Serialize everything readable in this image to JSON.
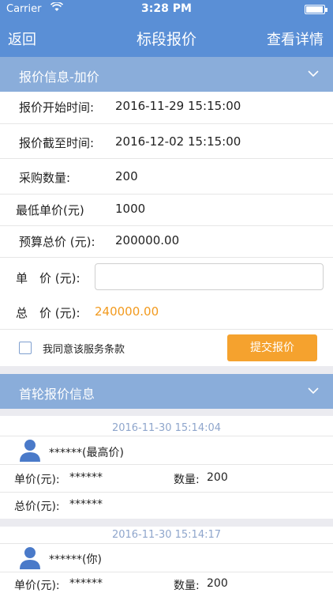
{
  "status_bar": {
    "carrier": "Carrier",
    "time": "3:28 PM"
  },
  "nav": {
    "back": "返回",
    "title": "标段报价",
    "detail": "查看详情"
  },
  "quote_section": {
    "header": "报价信息-加价",
    "rows": [
      {
        "label": "报价开始时间:",
        "value": "2016-11-29 15:15:00"
      },
      {
        "label": "报价截至时间:",
        "value": "2016-12-02 15:15:00"
      },
      {
        "label": "采购数量:",
        "value": "200"
      },
      {
        "label": "最低单价(元)",
        "value": "1000"
      },
      {
        "label": "预算总价 (元):",
        "value": "200000.00"
      }
    ],
    "unit_price_label": "单　价 (元):",
    "unit_price_value": "",
    "total_label": "总　价 (元):",
    "total_value": "240000.00",
    "agree_text": "我同意该服务条款",
    "submit_label": "提交报价"
  },
  "first_round": {
    "header": "首轮报价信息",
    "bids": [
      {
        "date": "2016-11-30 15:14:04",
        "name": "******(最高价)",
        "unit_label": "单价(元):",
        "unit_value": "******",
        "qty_label": "数量:",
        "qty_value": "200",
        "total_label": "总价(元):",
        "total_value": "******"
      },
      {
        "date": "2016-11-30 15:14:17",
        "name": "******(你)",
        "unit_label": "单价(元):",
        "unit_value": "******",
        "qty_label": "数量:",
        "qty_value": "200"
      }
    ]
  },
  "colors": {
    "nav": "#5a8fd6",
    "section": "#8aadda",
    "accent": "#f5a22e",
    "total": "#f29a1e"
  }
}
